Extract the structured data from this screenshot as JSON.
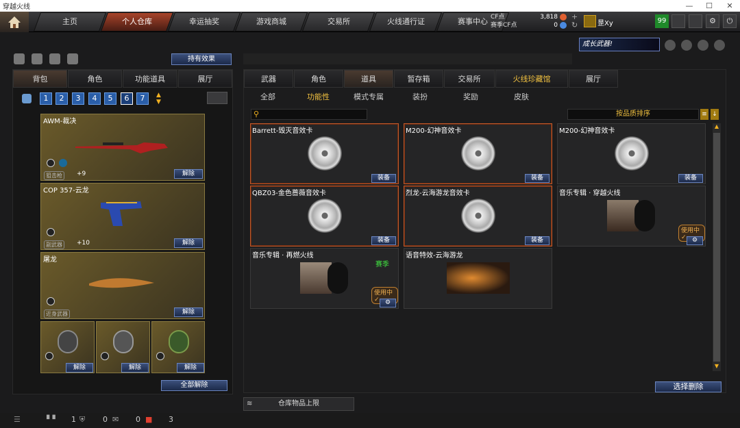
{
  "window": {
    "title": "穿越火线",
    "controls": [
      "—",
      "☐",
      "✕"
    ]
  },
  "nav": {
    "tabs": [
      "主页",
      "个人仓库",
      "幸运抽奖",
      "游戏商城",
      "交易所",
      "火线通行证",
      "赛事中心"
    ],
    "active": "个人仓库"
  },
  "currency": {
    "cf_label": "CF点",
    "cf_value": "3,818",
    "bonus_label": "赛季CF点",
    "bonus_value": "0",
    "plus": "+",
    "refresh": "↻"
  },
  "user": {
    "name": "昰Xy",
    "level": "99"
  },
  "left": {
    "effect_btn": "持有效果",
    "tabs": [
      "背包",
      "角色",
      "功能道具",
      "展厅"
    ],
    "pages": [
      "1",
      "2",
      "3",
      "4",
      "5",
      "6",
      "7"
    ],
    "weapons": [
      {
        "name": "AWM-裁决",
        "tag": "狙击枪",
        "stat": "+9",
        "btn": "解除"
      },
      {
        "name": "COP 357-云龙",
        "tag": "副武器",
        "stat": "+10",
        "btn": "解除"
      },
      {
        "name": "屠龙",
        "tag": "近身武器",
        "stat": "",
        "btn": "解除"
      }
    ],
    "grenades": [
      "解除",
      "解除",
      "解除"
    ],
    "unequip_all": "全部解除"
  },
  "right": {
    "banner": "成长武器!",
    "tabs": [
      "武器",
      "角色",
      "道具",
      "暂存箱",
      "交易所",
      "火线珍藏馆",
      "展厅"
    ],
    "active_tab": "道具",
    "filters": [
      "全部",
      "功能性",
      "模式专属",
      "装扮",
      "奖励",
      "皮肤"
    ],
    "active_filter": "功能性",
    "search_placeholder": "",
    "sort_label": "按品质排序",
    "items": [
      {
        "name": "Barrett-毁灭音效卡",
        "btn": "装备",
        "sel": true
      },
      {
        "name": "M200-幻神音效卡",
        "btn": "装备",
        "sel": true
      },
      {
        "name": "M200-幻神音效卡",
        "btn": "装备",
        "sel": false
      },
      {
        "name": "QBZ03-金色蔷薇音效卡",
        "btn": "装备",
        "sel": true
      },
      {
        "name": "烈龙-云海游龙音效卡",
        "btn": "装备",
        "sel": true
      },
      {
        "name": "音乐专辑 · 穿越火线",
        "btn": "⚙",
        "inuse": "使用中✓",
        "sel": false
      },
      {
        "name": "音乐专辑 · 再燃火线",
        "btn": "⚙",
        "inuse": "使用中✓",
        "badge": "赛季",
        "sel": false
      },
      {
        "name": "语音特效-云海游龙",
        "btn": "",
        "sel": false
      }
    ],
    "select_delete": "选择删除",
    "capacity": "仓库物品上限"
  },
  "bottom": {
    "count1": "1",
    "count2": "0",
    "count3": "0",
    "count4": "3"
  }
}
